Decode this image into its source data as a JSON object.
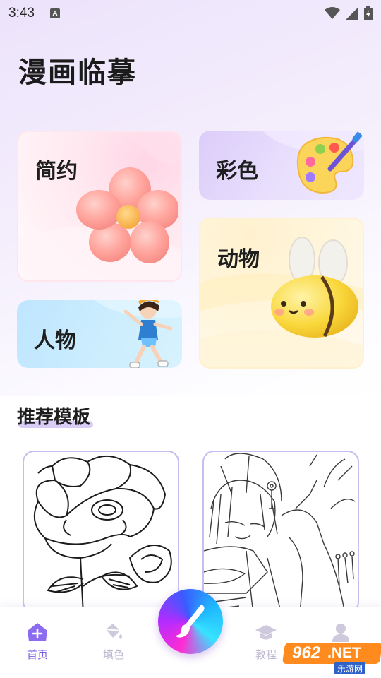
{
  "status_bar": {
    "time": "3:43",
    "notification_letter": "A"
  },
  "app_title": "漫画临摹",
  "categories": [
    {
      "label": "简约"
    },
    {
      "label": "彩色"
    },
    {
      "label": "动物"
    },
    {
      "label": "人物"
    }
  ],
  "section": {
    "title": "推荐模板"
  },
  "tabbar": {
    "home_label": "首页",
    "fill_label": "填色",
    "learn_label": "教程",
    "me_label": ""
  },
  "watermark": {
    "number": "962",
    "suffix": ".NET",
    "sub": "乐游网"
  },
  "colors": {
    "accent": "#7a5ce0",
    "inactive": "#bdb6cf"
  }
}
